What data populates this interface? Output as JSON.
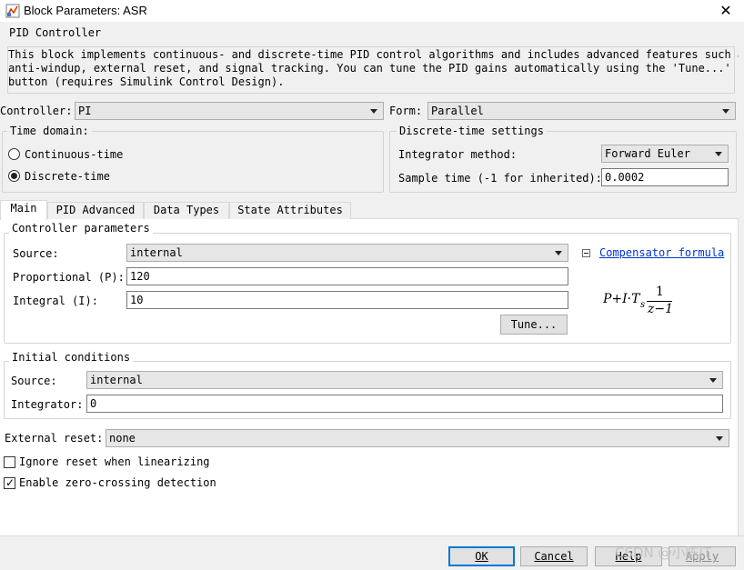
{
  "window": {
    "title": "Block Parameters: ASR",
    "close_glyph": "✕"
  },
  "header": {
    "block_type": "PID Controller",
    "description_lines": [
      "This block implements continuous- and discrete-time PID control algorithms and includes advanced features such as",
      "anti-windup, external reset, and signal tracking. You can tune the PID gains automatically using the 'Tune...'",
      "button (requires Simulink Control Design)."
    ]
  },
  "controller": {
    "label": "Controller:",
    "value": "PI"
  },
  "form": {
    "label": "Form:",
    "value": "Parallel"
  },
  "time_domain": {
    "title": "Time domain:",
    "options": [
      {
        "label": "Continuous-time",
        "selected": false
      },
      {
        "label": "Discrete-time",
        "selected": true
      }
    ]
  },
  "discrete_settings": {
    "title": "Discrete-time settings",
    "integrator_method_label": "Integrator method:",
    "integrator_method_value": "Forward Euler",
    "sample_time_label": "Sample time (-1 for inherited):",
    "sample_time_value": "0.0002"
  },
  "tabs": [
    {
      "label": "Main",
      "active": true
    },
    {
      "label": "PID Advanced",
      "active": false
    },
    {
      "label": "Data Types",
      "active": false
    },
    {
      "label": "State Attributes",
      "active": false
    }
  ],
  "controller_parameters": {
    "title": "Controller parameters",
    "source_label": "Source:",
    "source_value": "internal",
    "p_label": "Proportional (P):",
    "p_value": "120",
    "i_label": "Integral (I):",
    "i_value": "10",
    "tune_label": "Tune...",
    "compensator_link": "Compensator formula",
    "formula": {
      "lhs": "P+I·T",
      "subscript": "s",
      "numerator": "1",
      "denominator": "z−1"
    }
  },
  "initial_conditions": {
    "title": "Initial conditions",
    "source_label": "Source:",
    "source_value": "internal",
    "integrator_label": "Integrator:",
    "integrator_value": "0"
  },
  "external_reset": {
    "label": "External reset:",
    "value": "none"
  },
  "checkboxes": [
    {
      "label": "Ignore reset when linearizing",
      "checked": false
    },
    {
      "label": "Enable zero-crossing detection",
      "checked": true
    }
  ],
  "footer": {
    "ok_label": "OK",
    "cancel_label": "Cancel",
    "help_label": "Help",
    "apply_label": "Apply"
  },
  "watermark": "CSDN @小陈IT"
}
